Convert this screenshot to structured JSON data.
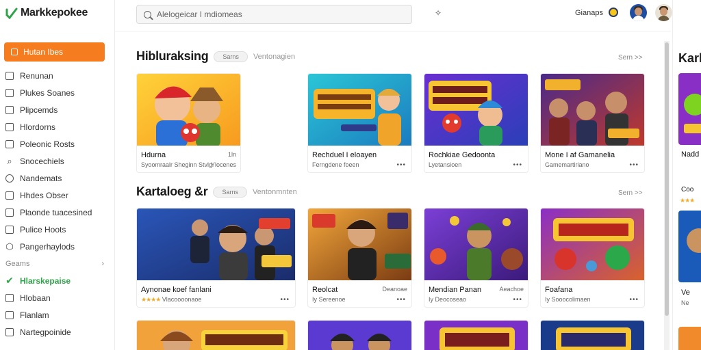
{
  "app": {
    "name": "Markkepokee"
  },
  "sidebar": {
    "primary_button": "Hutan Ibes",
    "items": [
      {
        "label": "Renunan",
        "icon": "document-icon"
      },
      {
        "label": "Plukes Soanes",
        "icon": "document-icon"
      },
      {
        "label": "Plipcemds",
        "icon": "document-icon"
      },
      {
        "label": "Hlordorns",
        "icon": "document-icon"
      },
      {
        "label": "Poleonic Rosts",
        "icon": "image-icon"
      },
      {
        "label": "Snocechiels",
        "icon": "tag-icon"
      },
      {
        "label": "Nandemats",
        "icon": "search-icon"
      },
      {
        "label": "Hhdes Obser",
        "icon": "document-icon"
      },
      {
        "label": "Plaonde tuacesined",
        "icon": "document-icon"
      },
      {
        "label": "Pulice Hoots",
        "icon": "document-icon"
      },
      {
        "label": "Pangerhaylods",
        "icon": "hexagon-icon"
      }
    ],
    "section_label": "Geams",
    "section_items": [
      {
        "label": "Hlarskepaise",
        "icon": "checkmark-icon",
        "active": true
      },
      {
        "label": "Hlobaan",
        "icon": "document-icon"
      },
      {
        "label": "Flanlam",
        "icon": "document-icon"
      },
      {
        "label": "Nartegpoinide",
        "icon": "image-icon"
      }
    ]
  },
  "topbar": {
    "search_placeholder": "Alelogeicar I mdiomeas",
    "label": "Gianaps",
    "mid_icon": "spark-icon"
  },
  "sections": [
    {
      "title": "Hibluraksing",
      "pill": "Sarns",
      "subtitle": "Ventonagien",
      "see_all": "Sern >>",
      "cards": [
        {
          "title": "Hdurna",
          "tag": "1ln",
          "meta": "Syoomraalr Sheginn Stvlg",
          "meta2": "Ylocenes"
        },
        {
          "title": "Rechduel I eloayen",
          "tag": "",
          "meta": "Ferngdene foeen",
          "meta2": ""
        },
        {
          "title": "Rochkiae Gedoonta",
          "tag": "",
          "meta": "Lyetansioen",
          "meta2": ""
        },
        {
          "title": "Mone I af Gamanelia",
          "tag": "",
          "meta": "Gamemartiriano",
          "meta2": ""
        }
      ]
    },
    {
      "title": "Kartaloeg &r",
      "pill": "Sarns",
      "subtitle": "Ventonmnten",
      "see_all": "Sern >>",
      "cards": [
        {
          "title": "Aynonae koef fanlani",
          "tag": "",
          "meta": "Vlacoooonaoe",
          "stars": "★★★★"
        },
        {
          "title": "Reolcat",
          "tag": "Deanoae",
          "meta": "Iy Sereenoe",
          "stars": ""
        },
        {
          "title": "Mendian Panan",
          "tag": "Aeachoe",
          "meta": "Iy Deocoseao",
          "stars": ""
        },
        {
          "title": "Foafana",
          "tag": "",
          "meta": "Iy Sooocolimaen",
          "stars": ""
        }
      ]
    }
  ],
  "right_panel": {
    "title": "Karl",
    "items": [
      "Nadd",
      "Coo",
      "Ve",
      "Ne"
    ]
  },
  "colors": {
    "accent": "#f57c1f",
    "active_green": "#2fa34a"
  }
}
